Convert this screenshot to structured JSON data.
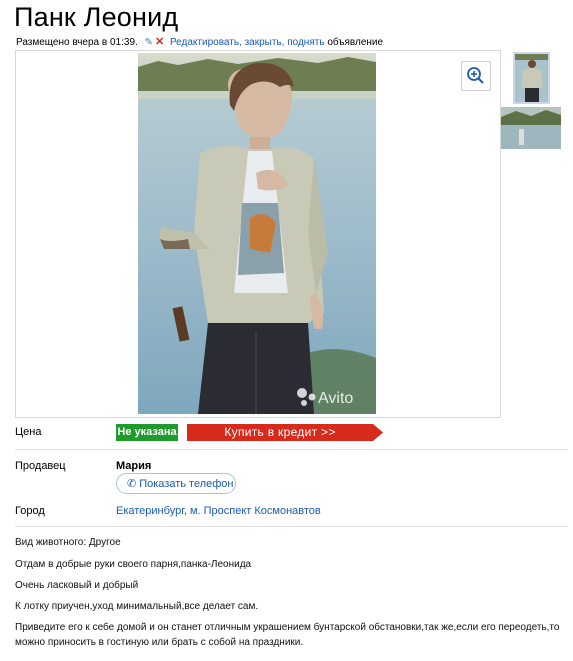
{
  "title": "Панк Леонид",
  "meta": {
    "posted": "Размещено вчера в 01:39.",
    "edit_links": "Редактировать, закрыть, поднять",
    "edit_suffix": "объявление"
  },
  "watermark": "Avito",
  "fields": {
    "price_label": "Цена",
    "price_value": "Не указана",
    "credit_button": "Купить в кредит >>",
    "seller_label": "Продавец",
    "seller_name": "Мария",
    "phone_button": "Показать телефон",
    "city_label": "Город",
    "city_value": "Екатеринбург, м. Проспект Космонавтов"
  },
  "description": [
    "Вид животного: Другое",
    "Отдам в добрые руки своего парня,панка-Леонида",
    "Очень ласковый и добрый",
    "К лотку приучен,уход минимальный,все делает сам.",
    "Приведите его к себе домой и он станет отличным украшением бунтарской обстановки,так же,если его переодеть,то можно приносить в гостиную или брать с собой на праздники."
  ],
  "colors": {
    "link": "#1a5bb5",
    "price_badge": "#1e9b2b",
    "credit_button": "#d62b1c"
  },
  "icons": [
    "pencil-icon",
    "close-icon",
    "zoom-in-icon",
    "phone-icon"
  ]
}
